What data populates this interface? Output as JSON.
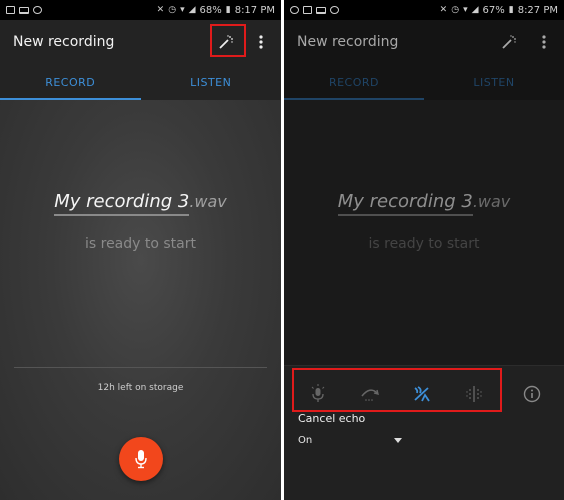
{
  "left_screen": {
    "status_bar": {
      "left_icons": [
        "gallery-icon",
        "laptop-icon",
        "screenshot-icon"
      ],
      "battery": "68%",
      "time": "8:17 PM"
    },
    "app_bar": {
      "title": "New recording"
    },
    "tabs": [
      {
        "label": "RECORD",
        "active": true
      },
      {
        "label": "LISTEN",
        "active": false
      }
    ],
    "file": {
      "name": "My recording 3",
      "extension": ".wav"
    },
    "ready_text": "is ready to start",
    "storage_text": "12h left on storage"
  },
  "right_screen": {
    "status_bar": {
      "left_icons": [
        "whatsapp-icon",
        "gallery-icon",
        "laptop-icon",
        "screenshot-icon"
      ],
      "battery": "67%",
      "time": "8:27 PM"
    },
    "app_bar": {
      "title": "New recording"
    },
    "tabs": [
      {
        "label": "RECORD",
        "active": true
      },
      {
        "label": "LISTEN",
        "active": false
      }
    ],
    "file": {
      "name": "My recording 3",
      "extension": ".wav"
    },
    "ready_text": "is ready to start",
    "effects": [
      {
        "name": "mic-gain",
        "active": false
      },
      {
        "name": "skip-silence",
        "active": false
      },
      {
        "name": "cancel-echo",
        "active": true
      },
      {
        "name": "noise-reduction",
        "active": false
      }
    ],
    "selected_effect_label": "Cancel echo",
    "selected_effect_value": "On"
  },
  "colors": {
    "accent": "#3d8fd8",
    "record_button": "#f2471c",
    "highlight_box": "#e01b1b"
  }
}
